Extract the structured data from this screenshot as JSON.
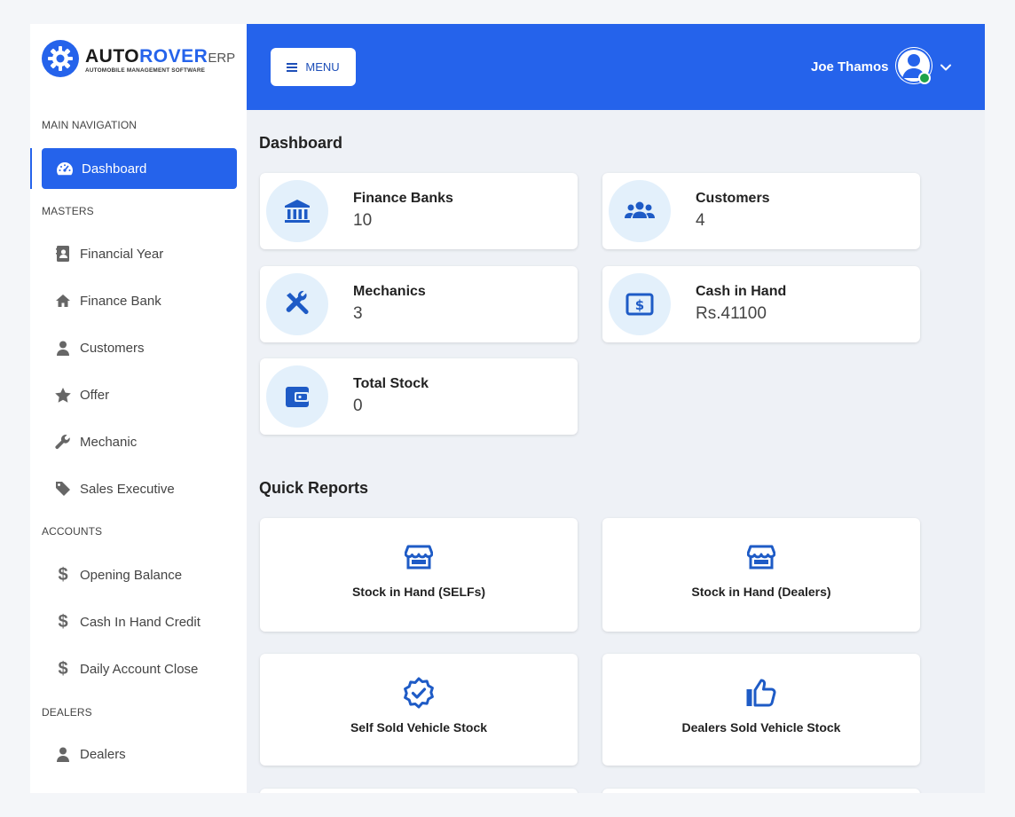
{
  "brand": {
    "name_part1": "AUTO",
    "name_part2": "ROVER",
    "suffix": "ERP",
    "tagline": "AUTOMOBILE MANAGEMENT SOFTWARE"
  },
  "header": {
    "menu_label": "MENU",
    "user_name": "Joe Thamos"
  },
  "sidebar": {
    "main_nav_label": "MAIN NAVIGATION",
    "dashboard_label": "Dashboard",
    "masters_label": "MASTERS",
    "masters": [
      {
        "label": "Financial Year",
        "icon": "contact-book-icon"
      },
      {
        "label": "Finance Bank",
        "icon": "home-icon"
      },
      {
        "label": "Customers",
        "icon": "user-icon"
      },
      {
        "label": "Offer",
        "icon": "star-icon"
      },
      {
        "label": "Mechanic",
        "icon": "wrench-icon"
      },
      {
        "label": "Sales Executive",
        "icon": "tag-icon"
      }
    ],
    "accounts_label": "ACCOUNTS",
    "accounts": [
      {
        "label": "Opening Balance",
        "icon": "dollar-icon"
      },
      {
        "label": "Cash In Hand Credit",
        "icon": "dollar-icon"
      },
      {
        "label": "Daily Account Close",
        "icon": "dollar-icon"
      }
    ],
    "dealers_label": "DEALERS",
    "dealers": [
      {
        "label": "Dealers",
        "icon": "user-icon"
      }
    ]
  },
  "main": {
    "dashboard_title": "Dashboard",
    "stats": [
      {
        "label": "Finance Banks",
        "value": "10",
        "icon": "bank-icon"
      },
      {
        "label": "Customers",
        "value": "4",
        "icon": "group-icon"
      },
      {
        "label": "Mechanics",
        "value": "3",
        "icon": "tools-icon"
      },
      {
        "label": "Cash in Hand",
        "value": "Rs.41100",
        "icon": "cash-icon"
      },
      {
        "label": "Total Stock",
        "value": "0",
        "icon": "wallet-icon"
      }
    ],
    "quick_reports_title": "Quick Reports",
    "reports": [
      {
        "label": "Stock in Hand (SELFs)",
        "icon": "store-icon"
      },
      {
        "label": "Stock in Hand (Dealers)",
        "icon": "store-icon"
      },
      {
        "label": "Self Sold Vehicle Stock",
        "icon": "verified-badge-icon"
      },
      {
        "label": "Dealers Sold Vehicle Stock",
        "icon": "thumbs-up-icon"
      }
    ]
  },
  "colors": {
    "primary": "#2563eb",
    "icon_blue": "#1e5bc6",
    "icon_bg": "#e3f0fb",
    "status_online": "#1fa34a"
  }
}
